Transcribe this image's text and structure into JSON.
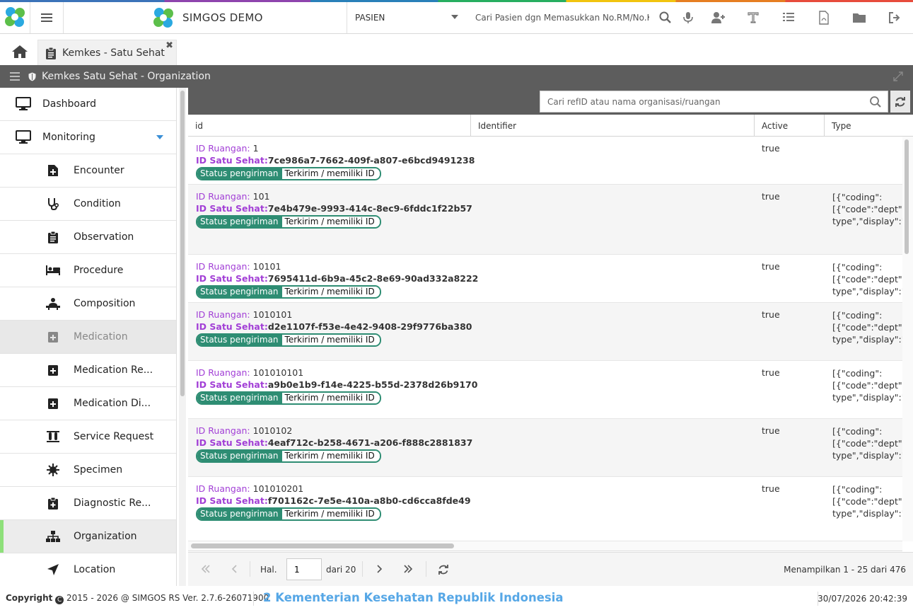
{
  "app": {
    "brand": "SIMGOS DEMO",
    "patient_dropdown": "PASIEN",
    "patient_search_placeholder": "Cari Pasien dgn Memasukkan No.RM/No.K"
  },
  "tabs": [
    {
      "label": "Kemkes - Satu Sehat"
    }
  ],
  "panel": {
    "title": "Kemkes Satu Sehat - Organization"
  },
  "sidebar": {
    "items": [
      {
        "label": "Dashboard",
        "icon": "monitor-icon",
        "level": "top"
      },
      {
        "label": "Monitoring",
        "icon": "monitor-icon",
        "level": "top"
      },
      {
        "label": "Encounter",
        "icon": "file-plus-icon",
        "level": "sub"
      },
      {
        "label": "Condition",
        "icon": "stethoscope-icon",
        "level": "sub"
      },
      {
        "label": "Observation",
        "icon": "clipboard-icon",
        "level": "sub"
      },
      {
        "label": "Procedure",
        "icon": "bed-icon",
        "level": "sub"
      },
      {
        "label": "Composition",
        "icon": "patient-icon",
        "level": "sub"
      },
      {
        "label": "Medication",
        "icon": "medkit-icon",
        "level": "sub",
        "state": "disabled"
      },
      {
        "label": "Medication Re...",
        "icon": "medkit-icon",
        "level": "sub"
      },
      {
        "label": "Medication Di...",
        "icon": "medkit-icon",
        "level": "sub"
      },
      {
        "label": "Service Request",
        "icon": "flask-icon",
        "level": "sub"
      },
      {
        "label": "Specimen",
        "icon": "virus-icon",
        "level": "sub"
      },
      {
        "label": "Diagnostic Re...",
        "icon": "clipboard-plus-icon",
        "level": "sub"
      },
      {
        "label": "Organization",
        "icon": "sitemap-icon",
        "level": "sub",
        "state": "active"
      },
      {
        "label": "Location",
        "icon": "location-arrow-icon",
        "level": "sub"
      }
    ]
  },
  "search": {
    "placeholder": "Cari refID atau nama organisasi/ruangan"
  },
  "table": {
    "columns": [
      "id",
      "Identifier",
      "Active",
      "Type"
    ],
    "labels": {
      "id_ruangan": "ID Ruangan:",
      "id_satu_sehat": "ID Satu Sehat:",
      "status_label": "Status pengiriman",
      "status_value": "Terkirim / memiliki ID"
    },
    "rows": [
      {
        "id_ruangan": "1",
        "satu_sehat": "7ce986a7-7662-409f-a807-e6bcd9491238",
        "active": "true",
        "type": [
          "",
          "",
          ""
        ]
      },
      {
        "id_ruangan": "101",
        "satu_sehat": "7e4b479e-9993-414c-8ec9-6fddc1f22b57",
        "active": "true",
        "type": [
          "[{\"coding\":",
          "[{\"code\":\"dept\",\"",
          "type\",\"display\":\""
        ]
      },
      {
        "id_ruangan": "10101",
        "satu_sehat": "7695411d-6b9a-45c2-8e69-90ad332a8222",
        "active": "true",
        "type": [
          "[{\"coding\":",
          "[{\"code\":\"dept\",\"",
          "type\",\"display\":\""
        ]
      },
      {
        "id_ruangan": "1010101",
        "satu_sehat": "d2e1107f-f53e-4e42-9408-29f9776ba380",
        "active": "true",
        "type": [
          "[{\"coding\":",
          "[{\"code\":\"dept\",\"",
          "type\",\"display\":\""
        ]
      },
      {
        "id_ruangan": "101010101",
        "satu_sehat": "a9b0e1b9-f14e-4225-b55d-2378d26b9170",
        "active": "true",
        "type": [
          "[{\"coding\":",
          "[{\"code\":\"dept\",\"",
          "type\",\"display\":\""
        ]
      },
      {
        "id_ruangan": "1010102",
        "satu_sehat": "4eaf712c-b258-4671-a206-f888c2881837",
        "active": "true",
        "type": [
          "[{\"coding\":",
          "[{\"code\":\"dept\",\"",
          "type\",\"display\":\""
        ]
      },
      {
        "id_ruangan": "101010201",
        "satu_sehat": "f701162c-7e5e-410a-a8b0-cd6cca8fde49",
        "active": "true",
        "type": [
          "[{\"coding\":",
          "[{\"code\":\"dept\",\"",
          "type\",\"display\":\""
        ]
      }
    ]
  },
  "pager": {
    "page_label": "Hal.",
    "page_value": "1",
    "of_label": "dari 20",
    "info": "Menampilkan 1 - 25 dari 476"
  },
  "footer": {
    "copyright_label": "Copyright",
    "copyright_text": "2015 - 2026 @ SIMGOS RS Ver. 2.7.6-26071900",
    "ministry": "2 Kementerian Kesehatan Republik Indonesia",
    "datetime": "30/07/2026 20:42:39"
  },
  "colors": {
    "accent_purple": "#a23fd6",
    "status_green": "#2e8d73",
    "header_gray": "#5d5d5d",
    "active_marker": "#8ee07a",
    "ministry_blue": "#56a7e6"
  }
}
